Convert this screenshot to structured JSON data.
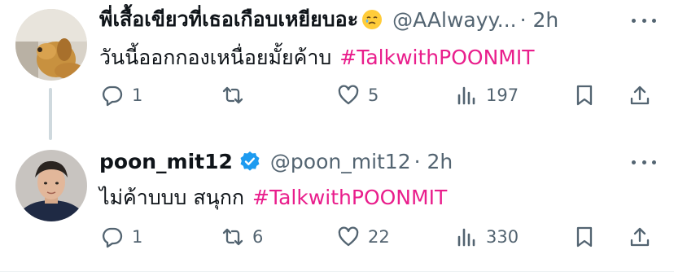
{
  "tweets": [
    {
      "display_name": "พี่เสื้อเขียวที่เธอเกือบเหยียบอะ",
      "handle": "@AAlwayy...",
      "time": "· 2h",
      "text": "วันนี้ออกกองเหนื่อยมั้ยค้าบ",
      "hashtag": "#TalkwithPOONMIT",
      "replies": "1",
      "retweets": "",
      "likes": "5",
      "views": "197"
    },
    {
      "display_name": "poon_mit12",
      "handle": "@poon_mit12",
      "time": "· 2h",
      "text": "ไม่ค้าบบบ สนุกก",
      "hashtag": "#TalkwithPOONMIT",
      "replies": "1",
      "retweets": "6",
      "likes": "22",
      "views": "330"
    }
  ],
  "colors": {
    "hashtag": "#e91e8c",
    "muted": "#536471",
    "verified": "#1d9bf0"
  }
}
